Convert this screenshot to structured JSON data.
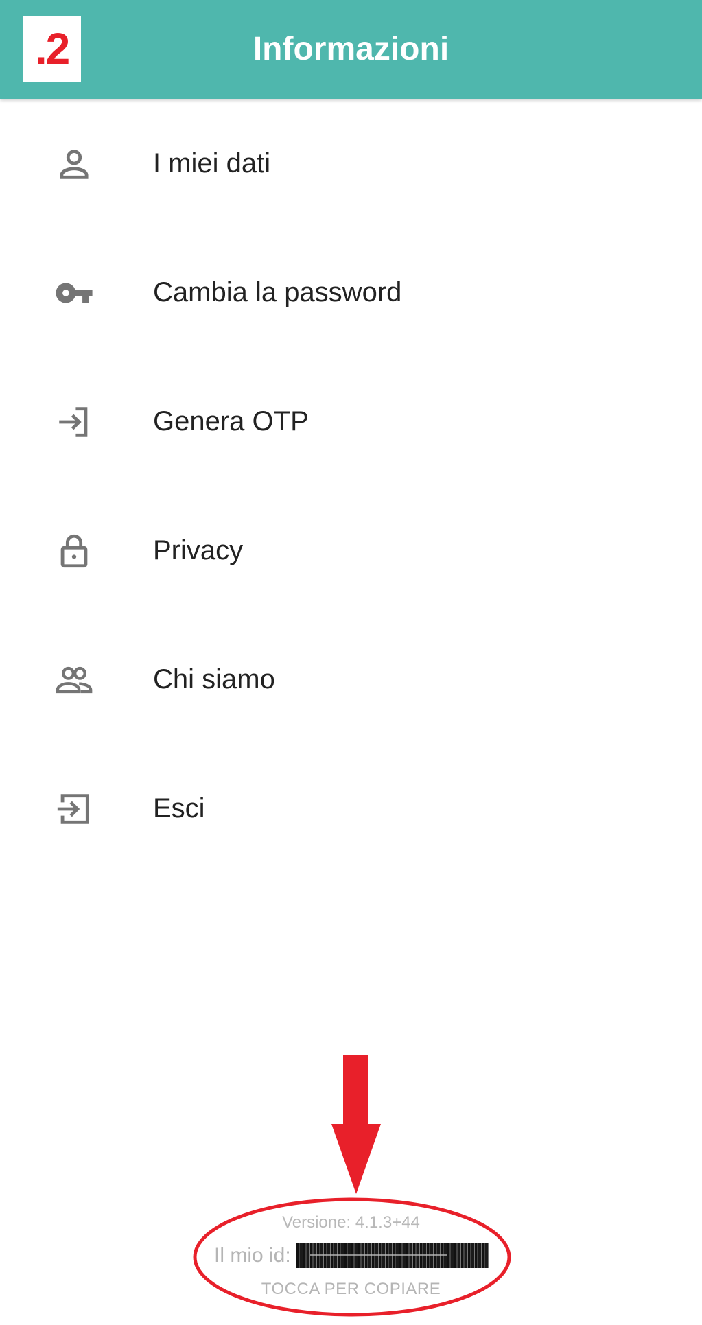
{
  "step_badge": ".2",
  "header": {
    "title": "Informazioni",
    "background_color": "#4fb7ad"
  },
  "menu": {
    "items": [
      {
        "label": "I miei dati",
        "icon": "person-icon"
      },
      {
        "label": "Cambia la password",
        "icon": "key-icon"
      },
      {
        "label": "Genera OTP",
        "icon": "login-arrow-icon"
      },
      {
        "label": "Privacy",
        "icon": "lock-icon"
      },
      {
        "label": "Chi siamo",
        "icon": "people-icon"
      },
      {
        "label": "Esci",
        "icon": "exit-icon"
      }
    ]
  },
  "footer": {
    "version_text": "Versione: 4.1.3+44",
    "id_label": "Il mio id:",
    "copy_hint": "TOCCA PER COPIARE"
  },
  "annotation": {
    "color": "#e8202a"
  }
}
